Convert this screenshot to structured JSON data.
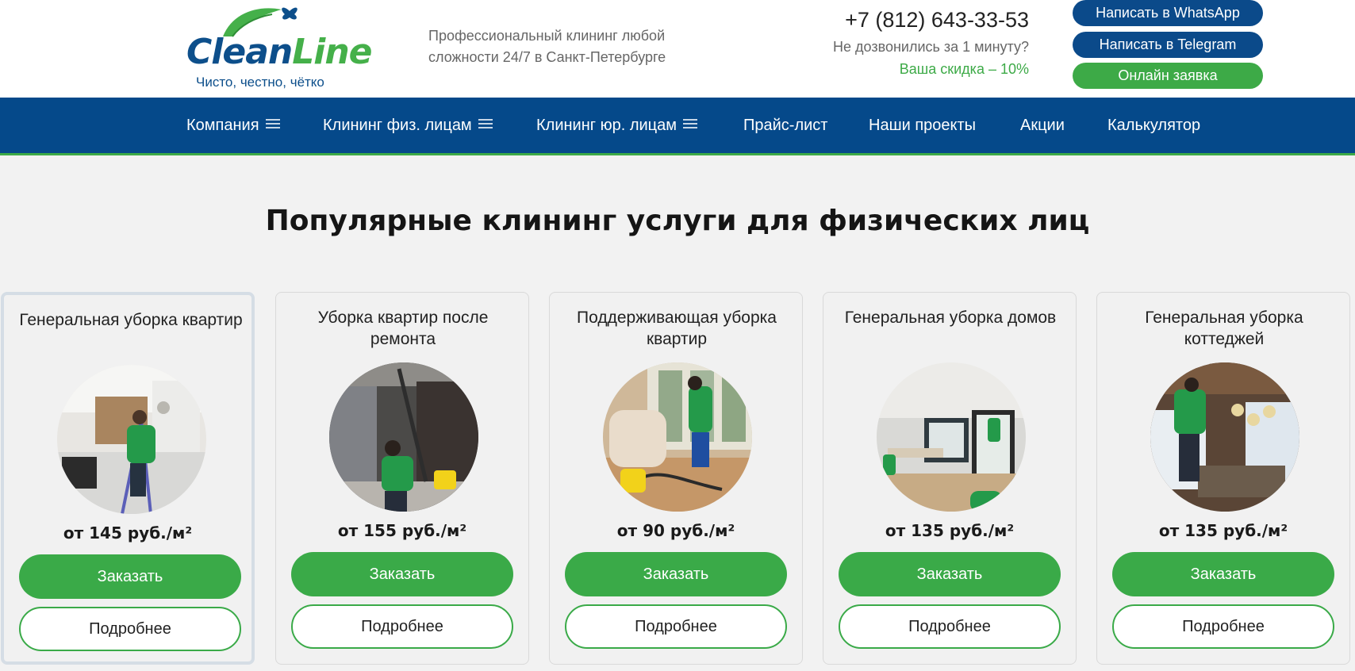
{
  "header": {
    "logo": {
      "word_part1": "Clean",
      "word_part2": "Line",
      "slogan": "Чисто, честно, чётко"
    },
    "tagline": "Профессиональный клининг любой сложности 24/7 в Санкт-Петербурге",
    "phone": "+7 (812) 643-33-53",
    "callback_text": "Не дозвонились за 1 минуту?",
    "discount_text": "Ваша скидка – 10%",
    "buttons": {
      "whatsapp": "Написать в WhatsApp",
      "telegram": "Написать в Telegram",
      "online": "Онлайн заявка"
    }
  },
  "nav": {
    "items": [
      {
        "label": "Компания",
        "menu_icon": "burger-icon"
      },
      {
        "label": "Клининг физ. лицам",
        "menu_icon": "burger-icon"
      },
      {
        "label": "Клининг юр. лицам",
        "menu_icon": "burger-icon"
      },
      {
        "label": "Прайс-лист"
      },
      {
        "label": "Наши проекты"
      },
      {
        "label": "Акции"
      },
      {
        "label": "Калькулятор"
      }
    ]
  },
  "section": {
    "title": "Популярные клининг услуги для физических лиц",
    "cards": [
      {
        "title": "Генеральная уборка квартир",
        "price": "от 145 руб./м²",
        "order_label": "Заказать",
        "more_label": "Подробнее"
      },
      {
        "title": "Уборка квартир после ремонта",
        "price": "от 155 руб./м²",
        "order_label": "Заказать",
        "more_label": "Подробнее"
      },
      {
        "title": "Поддерживающая уборка квартир",
        "price": "от 90 руб./м²",
        "order_label": "Заказать",
        "more_label": "Подробнее"
      },
      {
        "title": "Генеральная уборка домов",
        "price": "от 135 руб./м²",
        "order_label": "Заказать",
        "more_label": "Подробнее"
      },
      {
        "title": "Генеральная уборка коттеджей",
        "price": "от 135 руб./м²",
        "order_label": "Заказать",
        "more_label": "Подробнее"
      }
    ]
  },
  "colors": {
    "brand_blue": "#05498a",
    "brand_green": "#3aaa48",
    "page_bg": "#f2f2f2"
  }
}
